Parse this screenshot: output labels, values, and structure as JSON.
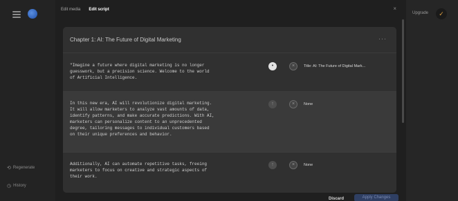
{
  "sidebar": {
    "regenerate_label": "Regenerate",
    "history_label": "History"
  },
  "topbar": {
    "upgrade_label": "Upgrade"
  },
  "modal": {
    "tabs": [
      {
        "label": "Edit media"
      },
      {
        "label": "Edit script"
      }
    ],
    "close_symbol": "×",
    "chapter_title": "Chapter 1: AI: The Future of Digital Marketing",
    "more_symbol": "···",
    "rows": [
      {
        "text": "\"Imagine a future where digital marketing is no longer\nguesswork, but a precision science. Welcome to the world\nof Artificial Intelligence.",
        "media_label": "Title: AI: The Future of Digital Mark..."
      },
      {
        "text": "In this new era, AI will revolutionize digital marketing.\nIt will allow marketers to analyze vast amounts of data,\nidentify patterns, and make accurate predictions. With AI,\nmarketers can personalize content to an unprecedented\ndegree, tailoring messages to individual customers based\non their unique preferences and behavior.",
        "media_label": "None"
      },
      {
        "text": "Additionally, AI can automate repetitive tasks, freeing\nmarketers to focus on creative and strategic aspects of\ntheir work.",
        "media_label": "None"
      }
    ],
    "discard_label": "Discard",
    "apply_label": "Apply Changes"
  },
  "icons": [
    "menu-icon",
    "globe-icon",
    "regenerate-icon",
    "history-icon",
    "user-icon",
    "close-icon",
    "more-icon",
    "expand-icon",
    "image-icon"
  ]
}
